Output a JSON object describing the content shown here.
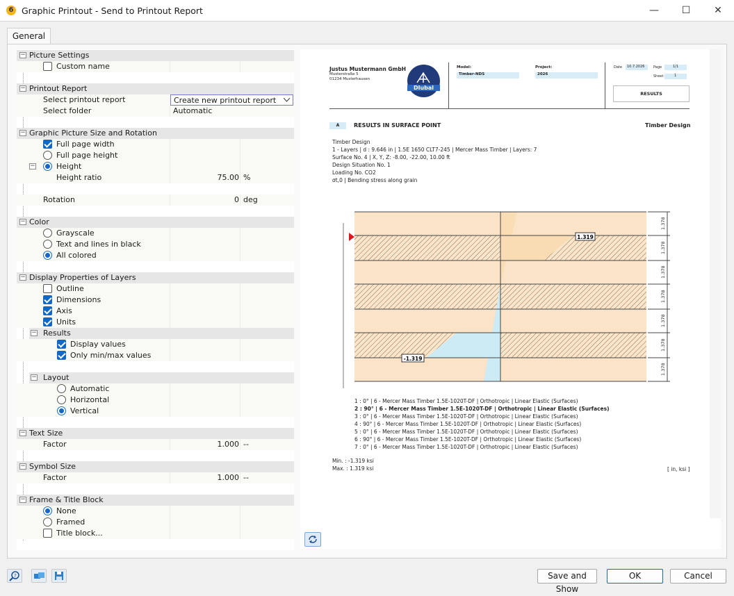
{
  "window": {
    "title": "Graphic Printout - Send to Printout Report",
    "min": "—",
    "max": "☐",
    "close": "✕"
  },
  "tabs": [
    {
      "label": "General"
    }
  ],
  "tree": {
    "picture_settings": {
      "header": "Picture Settings",
      "custom_name": "Custom name"
    },
    "printout_report": {
      "header": "Printout Report",
      "select_report": "Select printout report",
      "select_report_value": "Create new printout report",
      "select_folder": "Select folder",
      "select_folder_value": "Automatic"
    },
    "size_rotation": {
      "header": "Graphic Picture Size and Rotation",
      "full_width": "Full page width",
      "full_height": "Full page height",
      "height": "Height",
      "height_ratio": "Height ratio",
      "height_ratio_value": "75.00",
      "height_ratio_unit": "%",
      "rotation": "Rotation",
      "rotation_value": "0",
      "rotation_unit": "deg"
    },
    "color": {
      "header": "Color",
      "grayscale": "Grayscale",
      "text_black": "Text and lines in black",
      "all_colored": "All colored"
    },
    "layers": {
      "header": "Display Properties of Layers",
      "outline": "Outline",
      "dimensions": "Dimensions",
      "axis": "Axis",
      "units": "Units",
      "results": "Results",
      "display_values": "Display values",
      "only_minmax": "Only min/max values",
      "layout": "Layout",
      "automatic": "Automatic",
      "horizontal": "Horizontal",
      "vertical": "Vertical"
    },
    "text_size": {
      "header": "Text Size",
      "factor": "Factor",
      "factor_value": "1.000",
      "factor_unit": "--"
    },
    "symbol_size": {
      "header": "Symbol Size",
      "factor": "Factor",
      "factor_value": "1.000",
      "factor_unit": "--"
    },
    "frame": {
      "header": "Frame & Title Block",
      "none": "None",
      "framed": "Framed",
      "title_block": "Title block..."
    }
  },
  "preview": {
    "company": "Justus Mustermann GmbH",
    "street": "Musterstraße 5",
    "city": "01234 Musterhausen",
    "logo_text": "Dlubal",
    "model_label": "Model:",
    "model_value": "Timber-NDS",
    "project_label": "Project:",
    "project_value": "2026",
    "date_label": "Date",
    "date_value": "10.7.2026",
    "page_label": "Page",
    "page_value": "1/1",
    "sheet_label": "Sheet",
    "sheet_value": "1",
    "results_box": "RESULTS",
    "section_marker": "A",
    "section_title": "RESULTS IN SURFACE POINT",
    "section_right": "Timber Design",
    "info": [
      "Timber Design",
      "1 - Layers | d : 9.646 in | 1.5E 1650 CLT7-245 | Mercer Mass Timber | Layers: 7",
      "Surface No. 4 | X, Y, Z: -8.00, -22.00, 10.00 ft",
      "Design Situation No. 1",
      "Loading No. CO2",
      "σt,0 | Bending stress along grain"
    ],
    "dim_label": "1.378",
    "max_label": "1.319",
    "min_label": "-1.319",
    "layers": [
      "1 :    0° | 6 - Mercer Mass Timber 1.5E-1020T-DF | Orthotropic | Linear Elastic (Surfaces)",
      "2 :  90° | 6 - Mercer Mass Timber 1.5E-1020T-DF | Orthotropic | Linear Elastic (Surfaces)",
      "3 :    0° | 6 - Mercer Mass Timber 1.5E-1020T-DF | Orthotropic | Linear Elastic (Surfaces)",
      "4 :  90° | 6 - Mercer Mass Timber 1.5E-1020T-DF | Orthotropic | Linear Elastic (Surfaces)",
      "5 :    0° | 6 - Mercer Mass Timber 1.5E-1020T-DF | Orthotropic | Linear Elastic (Surfaces)",
      "6 :  90° | 6 - Mercer Mass Timber 1.5E-1020T-DF | Orthotropic | Linear Elastic (Surfaces)",
      "7 :    0° | 6 - Mercer Mass Timber 1.5E-1020T-DF | Orthotropic | Linear Elastic (Surfaces)"
    ],
    "min_text": "Min. : -1.319 ksi",
    "max_text": "Max. : 1.319 ksi",
    "units": "[ in, ksi ]"
  },
  "buttons": {
    "save_show": "Save and Show",
    "ok": "OK",
    "cancel": "Cancel"
  },
  "colors": {
    "accent": "#1368c4",
    "wood": "#fbe3c7",
    "stress_pos": "#f9dcb3",
    "stress_neg": "#cdebf5",
    "marker": "#e0171f"
  }
}
